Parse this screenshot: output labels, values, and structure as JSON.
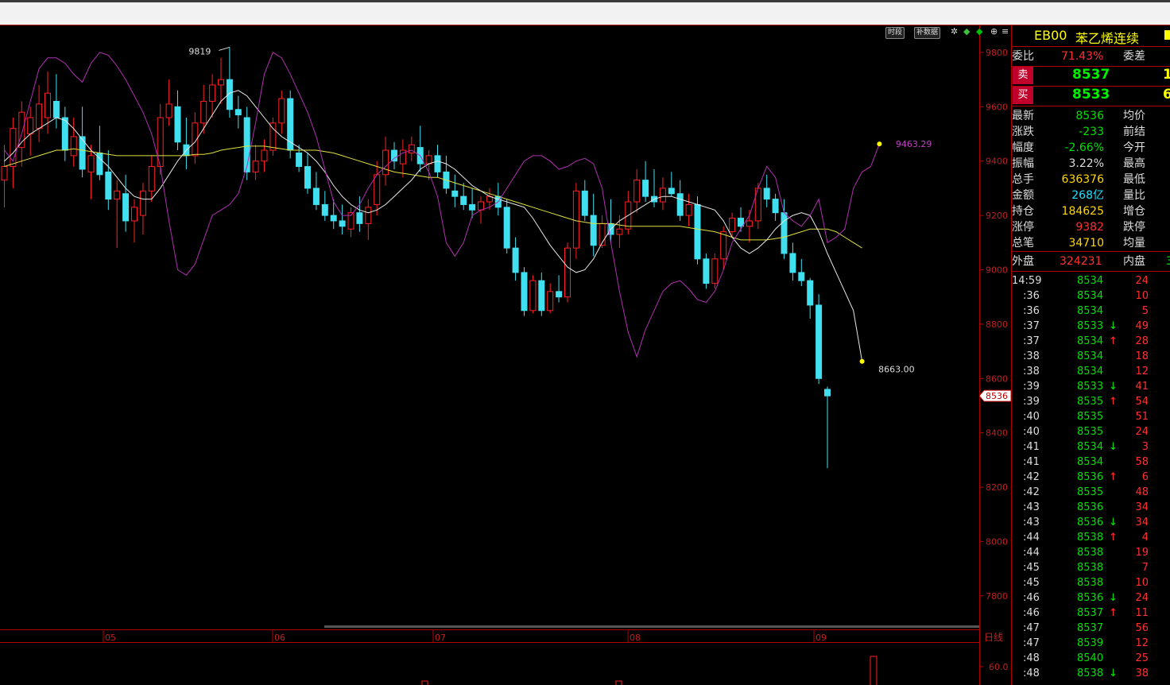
{
  "toolbar": {
    "btn_timeshare": "时段",
    "btn_supplement": "补数据"
  },
  "quote": {
    "code": "EB00",
    "name": "苯乙烯连续",
    "rows_top": [
      {
        "label": "委比",
        "value": "71.43%",
        "label2": "委差",
        "color": "#ff3030"
      }
    ],
    "sell": {
      "label": "卖",
      "price": "8537",
      "vol": "1"
    },
    "buy": {
      "label": "买",
      "price": "8533",
      "vol": "6"
    },
    "stats": [
      {
        "label": "最新",
        "value": "8536",
        "label2": "均价",
        "color": "#00e000"
      },
      {
        "label": "涨跌",
        "value": "-233",
        "label2": "前结",
        "color": "#00e000"
      },
      {
        "label": "幅度",
        "value": "-2.66%",
        "label2": "今开",
        "color": "#00e000"
      },
      {
        "label": "振幅",
        "value": "3.22%",
        "label2": "最高",
        "color": "#ddd"
      },
      {
        "label": "总手",
        "value": "636376",
        "label2": "最低",
        "color": "#ffd700"
      },
      {
        "label": "金额",
        "value": "268亿",
        "label2": "量比",
        "color": "#1fe0ff"
      },
      {
        "label": "持仓",
        "value": "184625",
        "label2": "增仓",
        "color": "#ffd700"
      },
      {
        "label": "涨停",
        "value": "9382",
        "label2": "跌停",
        "color": "#ff3030"
      },
      {
        "label": "总笔",
        "value": "34710",
        "label2": "均量",
        "color": "#ffd700"
      }
    ],
    "outer": {
      "label": "外盘",
      "value": "324231",
      "label2": "内盘",
      "value2": "3"
    },
    "ticks": [
      {
        "time": "14:59",
        "price": "8534",
        "arrow": "",
        "vol": "24"
      },
      {
        "time": ":36",
        "price": "8534",
        "arrow": "",
        "vol": "10"
      },
      {
        "time": ":36",
        "price": "8534",
        "arrow": "",
        "vol": "5"
      },
      {
        "time": ":37",
        "price": "8533",
        "arrow": "↓",
        "vol": "49"
      },
      {
        "time": ":37",
        "price": "8534",
        "arrow": "↑",
        "vol": "28"
      },
      {
        "time": ":38",
        "price": "8534",
        "arrow": "",
        "vol": "18"
      },
      {
        "time": ":38",
        "price": "8534",
        "arrow": "",
        "vol": "12"
      },
      {
        "time": ":39",
        "price": "8533",
        "arrow": "↓",
        "vol": "41"
      },
      {
        "time": ":39",
        "price": "8535",
        "arrow": "↑",
        "vol": "54"
      },
      {
        "time": ":40",
        "price": "8535",
        "arrow": "",
        "vol": "51"
      },
      {
        "time": ":40",
        "price": "8535",
        "arrow": "",
        "vol": "24"
      },
      {
        "time": ":41",
        "price": "8534",
        "arrow": "↓",
        "vol": "3"
      },
      {
        "time": ":41",
        "price": "8534",
        "arrow": "",
        "vol": "58"
      },
      {
        "time": ":42",
        "price": "8536",
        "arrow": "↑",
        "vol": "6"
      },
      {
        "time": ":42",
        "price": "8535",
        "arrow": "",
        "vol": "48"
      },
      {
        "time": ":43",
        "price": "8536",
        "arrow": "",
        "vol": "34"
      },
      {
        "time": ":43",
        "price": "8536",
        "arrow": "↓",
        "vol": "34"
      },
      {
        "time": ":44",
        "price": "8538",
        "arrow": "↑",
        "vol": "4"
      },
      {
        "time": ":44",
        "price": "8538",
        "arrow": "",
        "vol": "19"
      },
      {
        "time": ":45",
        "price": "8538",
        "arrow": "",
        "vol": "7"
      },
      {
        "time": ":45",
        "price": "8538",
        "arrow": "",
        "vol": "10"
      },
      {
        "time": ":46",
        "price": "8536",
        "arrow": "↓",
        "vol": "24"
      },
      {
        "time": ":46",
        "price": "8537",
        "arrow": "↑",
        "vol": "11"
      },
      {
        "time": ":47",
        "price": "8537",
        "arrow": "",
        "vol": "56"
      },
      {
        "time": ":47",
        "price": "8539",
        "arrow": "",
        "vol": "12"
      },
      {
        "time": ":48",
        "price": "8540",
        "arrow": "",
        "vol": "25"
      },
      {
        "time": ":48",
        "price": "8538",
        "arrow": "↓",
        "vol": "38"
      }
    ]
  },
  "chart_data": {
    "type": "candlestick",
    "ylim": [
      7700,
      9870
    ],
    "yticks": [
      7800,
      8000,
      8200,
      8400,
      8600,
      8800,
      9000,
      9200,
      9400,
      9600,
      9800
    ],
    "x_month_labels": [
      "05",
      "06",
      "07",
      "08",
      "09"
    ],
    "period_label": "日线",
    "annotations": {
      "high_label": "9819",
      "magenta_end_label": "9463.29",
      "white_end_label": "8663.00",
      "last_price_tag": "8536"
    },
    "colors": {
      "up": "#ff2020",
      "down": "#40e0f0",
      "ma_white": "#e8e8e8",
      "ma_yellow": "#e0e040",
      "magenta": "#b030b0"
    },
    "candles": [
      {
        "o": 9330,
        "h": 9460,
        "l": 9230,
        "c": 9380
      },
      {
        "o": 9380,
        "h": 9560,
        "l": 9300,
        "c": 9520
      },
      {
        "o": 9450,
        "h": 9620,
        "l": 9380,
        "c": 9580
      },
      {
        "o": 9500,
        "h": 9600,
        "l": 9420,
        "c": 9560
      },
      {
        "o": 9520,
        "h": 9680,
        "l": 9470,
        "c": 9610
      },
      {
        "o": 9560,
        "h": 9730,
        "l": 9500,
        "c": 9650
      },
      {
        "o": 9620,
        "h": 9720,
        "l": 9520,
        "c": 9560
      },
      {
        "o": 9560,
        "h": 9600,
        "l": 9400,
        "c": 9440
      },
      {
        "o": 9420,
        "h": 9560,
        "l": 9380,
        "c": 9490
      },
      {
        "o": 9490,
        "h": 9600,
        "l": 9340,
        "c": 9370
      },
      {
        "o": 9360,
        "h": 9460,
        "l": 9260,
        "c": 9420
      },
      {
        "o": 9430,
        "h": 9530,
        "l": 9330,
        "c": 9350
      },
      {
        "o": 9360,
        "h": 9440,
        "l": 9220,
        "c": 9260
      },
      {
        "o": 9260,
        "h": 9330,
        "l": 9080,
        "c": 9290
      },
      {
        "o": 9280,
        "h": 9350,
        "l": 9140,
        "c": 9180
      },
      {
        "o": 9180,
        "h": 9260,
        "l": 9100,
        "c": 9230
      },
      {
        "o": 9200,
        "h": 9320,
        "l": 9130,
        "c": 9290
      },
      {
        "o": 9290,
        "h": 9420,
        "l": 9250,
        "c": 9380
      },
      {
        "o": 9380,
        "h": 9610,
        "l": 9350,
        "c": 9560
      },
      {
        "o": 9560,
        "h": 9700,
        "l": 9530,
        "c": 9610
      },
      {
        "o": 9600,
        "h": 9660,
        "l": 9440,
        "c": 9470
      },
      {
        "o": 9460,
        "h": 9560,
        "l": 9370,
        "c": 9420
      },
      {
        "o": 9420,
        "h": 9580,
        "l": 9390,
        "c": 9540
      },
      {
        "o": 9540,
        "h": 9680,
        "l": 9500,
        "c": 9620
      },
      {
        "o": 9620,
        "h": 9720,
        "l": 9560,
        "c": 9680
      },
      {
        "o": 9680,
        "h": 9780,
        "l": 9610,
        "c": 9700
      },
      {
        "o": 9700,
        "h": 9819,
        "l": 9560,
        "c": 9590
      },
      {
        "o": 9590,
        "h": 9640,
        "l": 9520,
        "c": 9570
      },
      {
        "o": 9560,
        "h": 9600,
        "l": 9330,
        "c": 9360
      },
      {
        "o": 9360,
        "h": 9460,
        "l": 9330,
        "c": 9400
      },
      {
        "o": 9400,
        "h": 9480,
        "l": 9360,
        "c": 9440
      },
      {
        "o": 9440,
        "h": 9560,
        "l": 9420,
        "c": 9540
      },
      {
        "o": 9540,
        "h": 9660,
        "l": 9500,
        "c": 9630
      },
      {
        "o": 9630,
        "h": 9660,
        "l": 9410,
        "c": 9440
      },
      {
        "o": 9430,
        "h": 9460,
        "l": 9360,
        "c": 9380
      },
      {
        "o": 9380,
        "h": 9430,
        "l": 9280,
        "c": 9300
      },
      {
        "o": 9300,
        "h": 9360,
        "l": 9220,
        "c": 9240
      },
      {
        "o": 9240,
        "h": 9290,
        "l": 9180,
        "c": 9200
      },
      {
        "o": 9200,
        "h": 9260,
        "l": 9150,
        "c": 9180
      },
      {
        "o": 9180,
        "h": 9240,
        "l": 9130,
        "c": 9160
      },
      {
        "o": 9150,
        "h": 9230,
        "l": 9120,
        "c": 9210
      },
      {
        "o": 9210,
        "h": 9270,
        "l": 9140,
        "c": 9170
      },
      {
        "o": 9170,
        "h": 9260,
        "l": 9110,
        "c": 9230
      },
      {
        "o": 9240,
        "h": 9400,
        "l": 9200,
        "c": 9350
      },
      {
        "o": 9350,
        "h": 9490,
        "l": 9310,
        "c": 9440
      },
      {
        "o": 9440,
        "h": 9470,
        "l": 9370,
        "c": 9400
      },
      {
        "o": 9390,
        "h": 9480,
        "l": 9340,
        "c": 9440
      },
      {
        "o": 9430,
        "h": 9490,
        "l": 9400,
        "c": 9460
      },
      {
        "o": 9450,
        "h": 9530,
        "l": 9360,
        "c": 9390
      },
      {
        "o": 9390,
        "h": 9440,
        "l": 9330,
        "c": 9420
      },
      {
        "o": 9420,
        "h": 9460,
        "l": 9340,
        "c": 9360
      },
      {
        "o": 9360,
        "h": 9420,
        "l": 9280,
        "c": 9300
      },
      {
        "o": 9290,
        "h": 9350,
        "l": 9230,
        "c": 9270
      },
      {
        "o": 9270,
        "h": 9320,
        "l": 9220,
        "c": 9240
      },
      {
        "o": 9240,
        "h": 9300,
        "l": 9190,
        "c": 9220
      },
      {
        "o": 9220,
        "h": 9270,
        "l": 9170,
        "c": 9250
      },
      {
        "o": 9250,
        "h": 9300,
        "l": 9220,
        "c": 9270
      },
      {
        "o": 9270,
        "h": 9320,
        "l": 9200,
        "c": 9230
      },
      {
        "o": 9230,
        "h": 9260,
        "l": 9060,
        "c": 9080
      },
      {
        "o": 9080,
        "h": 9120,
        "l": 8960,
        "c": 8990
      },
      {
        "o": 8990,
        "h": 9010,
        "l": 8830,
        "c": 8850
      },
      {
        "o": 8850,
        "h": 8980,
        "l": 8840,
        "c": 8960
      },
      {
        "o": 8960,
        "h": 8990,
        "l": 8830,
        "c": 8850
      },
      {
        "o": 8850,
        "h": 8950,
        "l": 8840,
        "c": 8920
      },
      {
        "o": 8920,
        "h": 8980,
        "l": 8880,
        "c": 8900
      },
      {
        "o": 8900,
        "h": 9100,
        "l": 8880,
        "c": 9080
      },
      {
        "o": 9080,
        "h": 9320,
        "l": 9040,
        "c": 9290
      },
      {
        "o": 9290,
        "h": 9330,
        "l": 9180,
        "c": 9200
      },
      {
        "o": 9200,
        "h": 9280,
        "l": 9050,
        "c": 9090
      },
      {
        "o": 9090,
        "h": 9200,
        "l": 9080,
        "c": 9170
      },
      {
        "o": 9170,
        "h": 9260,
        "l": 9100,
        "c": 9130
      },
      {
        "o": 9130,
        "h": 9200,
        "l": 9080,
        "c": 9150
      },
      {
        "o": 9150,
        "h": 9290,
        "l": 9130,
        "c": 9250
      },
      {
        "o": 9250,
        "h": 9370,
        "l": 9210,
        "c": 9330
      },
      {
        "o": 9330,
        "h": 9400,
        "l": 9250,
        "c": 9270
      },
      {
        "o": 9270,
        "h": 9370,
        "l": 9230,
        "c": 9250
      },
      {
        "o": 9250,
        "h": 9340,
        "l": 9220,
        "c": 9300
      },
      {
        "o": 9300,
        "h": 9360,
        "l": 9270,
        "c": 9280
      },
      {
        "o": 9280,
        "h": 9330,
        "l": 9180,
        "c": 9200
      },
      {
        "o": 9200,
        "h": 9280,
        "l": 9160,
        "c": 9240
      },
      {
        "o": 9240,
        "h": 9270,
        "l": 9020,
        "c": 9040
      },
      {
        "o": 9040,
        "h": 9060,
        "l": 8930,
        "c": 8950
      },
      {
        "o": 8950,
        "h": 9060,
        "l": 8930,
        "c": 9040
      },
      {
        "o": 9040,
        "h": 9160,
        "l": 9000,
        "c": 9140
      },
      {
        "o": 9140,
        "h": 9210,
        "l": 9120,
        "c": 9190
      },
      {
        "o": 9190,
        "h": 9230,
        "l": 9140,
        "c": 9160
      },
      {
        "o": 9160,
        "h": 9220,
        "l": 9100,
        "c": 9180
      },
      {
        "o": 9180,
        "h": 9320,
        "l": 9150,
        "c": 9300
      },
      {
        "o": 9300,
        "h": 9350,
        "l": 9230,
        "c": 9260
      },
      {
        "o": 9260,
        "h": 9280,
        "l": 9180,
        "c": 9210
      },
      {
        "o": 9210,
        "h": 9260,
        "l": 9040,
        "c": 9060
      },
      {
        "o": 9060,
        "h": 9100,
        "l": 8960,
        "c": 8990
      },
      {
        "o": 8990,
        "h": 9040,
        "l": 8940,
        "c": 8960
      },
      {
        "o": 8960,
        "h": 8970,
        "l": 8820,
        "c": 8870
      },
      {
        "o": 8870,
        "h": 8910,
        "l": 8580,
        "c": 8600
      },
      {
        "o": 8560,
        "h": 8570,
        "l": 8270,
        "c": 8536
      }
    ],
    "ma_white": [
      9400,
      9430,
      9470,
      9500,
      9520,
      9540,
      9560,
      9550,
      9520,
      9480,
      9440,
      9410,
      9380,
      9340,
      9300,
      9270,
      9260,
      9260,
      9300,
      9350,
      9400,
      9440,
      9470,
      9520,
      9570,
      9620,
      9650,
      9660,
      9640,
      9600,
      9560,
      9520,
      9490,
      9470,
      9450,
      9430,
      9400,
      9360,
      9310,
      9270,
      9240,
      9220,
      9210,
      9220,
      9240,
      9270,
      9300,
      9330,
      9370,
      9390,
      9400,
      9390,
      9370,
      9340,
      9310,
      9290,
      9270,
      9260,
      9250,
      9240,
      9230,
      9190,
      9140,
      9090,
      9050,
      9010,
      8990,
      9000,
      9040,
      9100,
      9150,
      9180,
      9200,
      9220,
      9240,
      9260,
      9270,
      9270,
      9260,
      9250,
      9240,
      9230,
      9220,
      9180,
      9120,
      9080,
      9060,
      9080,
      9110,
      9150,
      9180,
      9200,
      9210,
      9200,
      9140,
      9060,
      8990,
      8920,
      8850,
      8663
    ],
    "ma_yellow": [
      9380,
      9390,
      9400,
      9410,
      9420,
      9430,
      9440,
      9440,
      9445,
      9440,
      9435,
      9430,
      9425,
      9420,
      9420,
      9420,
      9420,
      9420,
      9420,
      9420,
      9420,
      9420,
      9425,
      9425,
      9430,
      9440,
      9445,
      9450,
      9455,
      9455,
      9455,
      9450,
      9445,
      9440,
      9440,
      9440,
      9440,
      9435,
      9430,
      9420,
      9410,
      9400,
      9390,
      9380,
      9370,
      9360,
      9355,
      9350,
      9345,
      9340,
      9340,
      9330,
      9320,
      9310,
      9300,
      9290,
      9280,
      9270,
      9260,
      9250,
      9240,
      9230,
      9220,
      9210,
      9200,
      9190,
      9180,
      9175,
      9170,
      9170,
      9170,
      9165,
      9160,
      9160,
      9160,
      9160,
      9160,
      9160,
      9160,
      9155,
      9150,
      9145,
      9140,
      9130,
      9120,
      9110,
      9110,
      9110,
      9110,
      9115,
      9120,
      9130,
      9140,
      9150,
      9150,
      9150,
      9140,
      9120,
      9100,
      9080
    ],
    "magenta": [
      9440,
      9400,
      9500,
      9620,
      9740,
      9780,
      9780,
      9760,
      9720,
      9690,
      9760,
      9800,
      9790,
      9750,
      9700,
      9640,
      9580,
      9500,
      9380,
      9180,
      9000,
      8980,
      9020,
      9110,
      9200,
      9220,
      9240,
      9280,
      9380,
      9540,
      9720,
      9800,
      9780,
      9720,
      9650,
      9580,
      9490,
      9370,
      9250,
      9200,
      9200,
      9240,
      9300,
      9350,
      9380,
      9410,
      9430,
      9440,
      9420,
      9360,
      9270,
      9100,
      9050,
      9100,
      9200,
      9220,
      9230,
      9250,
      9300,
      9350,
      9400,
      9420,
      9420,
      9400,
      9370,
      9380,
      9400,
      9410,
      9390,
      9300,
      9100,
      8920,
      8770,
      8680,
      8780,
      8850,
      8920,
      8950,
      8960,
      8930,
      8890,
      8880,
      8920,
      9000,
      9100,
      9150,
      9200,
      9300,
      9380,
      9340,
      9210,
      9180,
      9160,
      9200,
      9260,
      9100,
      9120,
      9150,
      9300,
      9360,
      9380,
      9463.29
    ]
  }
}
